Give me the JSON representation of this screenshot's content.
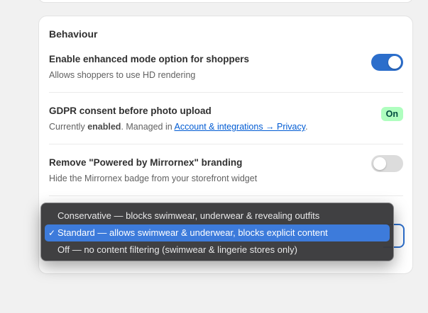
{
  "section": {
    "title": "Behaviour"
  },
  "settings": [
    {
      "title": "Enable enhanced mode option for shoppers",
      "desc": "Allows shoppers to use HD rendering",
      "control": "toggle",
      "enabled": true
    },
    {
      "title": "GDPR consent before photo upload",
      "desc_prefix": "Currently ",
      "desc_bold": "enabled",
      "desc_middle": ". Managed in ",
      "desc_link": "Account & integrations → Privacy",
      "desc_suffix": ".",
      "control": "badge",
      "badge": "On"
    },
    {
      "title": "Remove \"Powered by Mirrornex\" branding",
      "desc": "Hide the Mirrornex badge from your storefront widget",
      "control": "toggle",
      "enabled": false
    }
  ],
  "content_filter": {
    "options": [
      {
        "label": "Conservative — blocks swimwear, underwear & revealing outfits",
        "selected": false
      },
      {
        "label": "Standard — allows swimwear & underwear, blocks explicit content",
        "selected": true
      },
      {
        "label": "Off — no content filtering (swimwear & lingerie stores only)",
        "selected": false
      }
    ],
    "check_mark": "✓"
  },
  "colors": {
    "accent": "#2c6ecb",
    "badge_bg": "#affebf",
    "badge_text": "#014b40",
    "link": "#005bd3",
    "menu_selected": "#3d7bdb"
  }
}
